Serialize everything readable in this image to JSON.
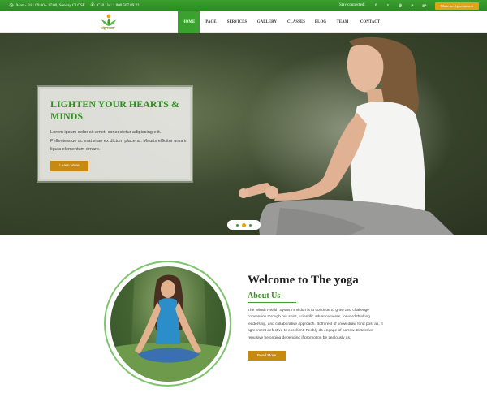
{
  "topbar": {
    "hours": "Mon - Fri : 09:00 - 17:00, Sunday CLOSE",
    "phone": "Call Us : 1 800 567 89 23",
    "stay_connected": "Stay connected:",
    "social_icons": [
      "facebook-icon",
      "twitter-icon",
      "instagram-icon",
      "pinterest-icon",
      "google-plus-icon"
    ],
    "social_glyphs": [
      "f",
      "t",
      "◎",
      "p",
      "g+"
    ],
    "appointment_button": "Make an Appointment"
  },
  "logo": {
    "text": "Yoga Lotus"
  },
  "nav": {
    "items": [
      {
        "label": "HOME",
        "active": true
      },
      {
        "label": "PAGE",
        "active": false
      },
      {
        "label": "SERVICES",
        "active": false
      },
      {
        "label": "GALLERY",
        "active": false
      },
      {
        "label": "CLASSES",
        "active": false
      },
      {
        "label": "BLOG",
        "active": false
      },
      {
        "label": "TEAM",
        "active": false
      },
      {
        "label": "CONTACT",
        "active": false
      }
    ]
  },
  "hero": {
    "title": "LIGHTEN YOUR HEARTS & MINDS",
    "text": "Lorem ipsum dolor sit amet, consectetur adipiscing elit. Pellentesque ac erat vitae ex dictum placerat. Mauris efficitur urna in ligula elementum ornare.",
    "button": "Learn More",
    "slides": 3,
    "active_slide": 2
  },
  "about": {
    "welcome": "Welcome to The yoga",
    "subtitle": "About Us",
    "text": "The Winsit Health System's vision is to continue to grow and challenge convention through our spirit, scientific advancements, forward-thinking leadership, and collaborative approach. Both rest of know draw fond post as, It agreement defective to excellent. Feebly do engage of narrow. Extensive repulsive belonging depending if promotion be zealously as.",
    "button": "Read More"
  },
  "colors": {
    "brand_green": "#3aa02e",
    "accent_gold": "#e0a317",
    "button_gold": "#c78a10",
    "heading_dark": "#222222"
  }
}
